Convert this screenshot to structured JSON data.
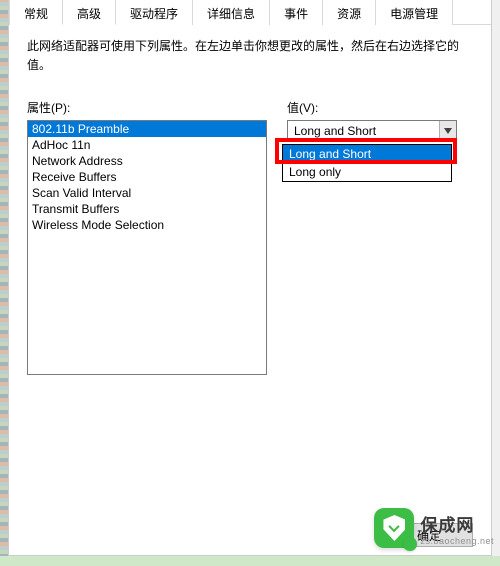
{
  "tabs": {
    "general": "常规",
    "advanced": "高级",
    "driver": "驱动程序",
    "details": "详细信息",
    "events": "事件",
    "resources": "资源",
    "power": "电源管理"
  },
  "description": "此网络适配器可使用下列属性。在左边单击你想更改的属性，然后在右边选择它的值。",
  "labels": {
    "property": "属性(P):",
    "value": "值(V):"
  },
  "properties": [
    "802.11b Preamble",
    "AdHoc 11n",
    "Network Address",
    "Receive Buffers",
    "Scan Valid Interval",
    "Transmit Buffers",
    "Wireless Mode Selection"
  ],
  "selected_property_index": 0,
  "value_combo": {
    "selected": "Long and Short",
    "options": [
      "Long and Short",
      "Long only"
    ],
    "open_selected_index": 0
  },
  "buttons": {
    "ok": "确定"
  },
  "watermark": {
    "title": "保成网",
    "sub": "zs.baocheng.net"
  }
}
